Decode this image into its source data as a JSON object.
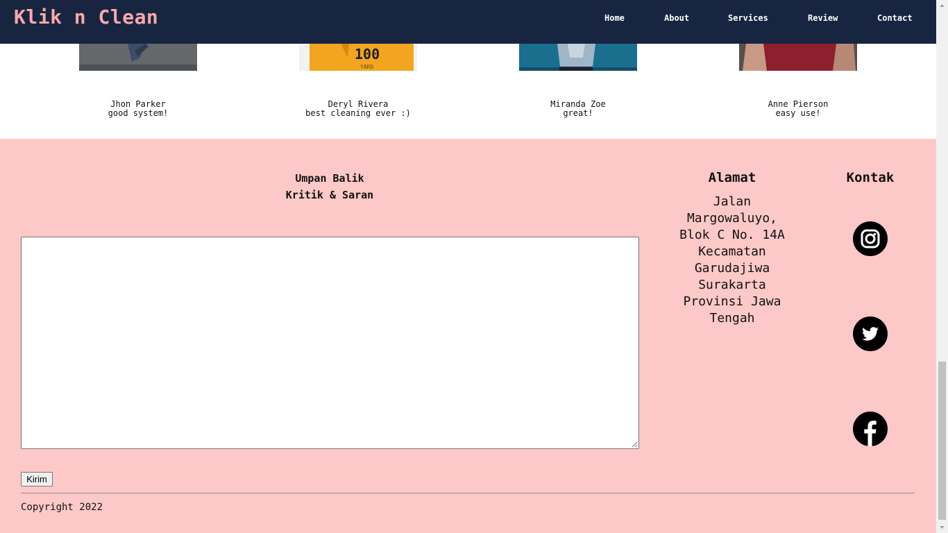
{
  "navbar": {
    "brand": "Klik n Clean",
    "items": [
      {
        "label": "Home"
      },
      {
        "label": "About"
      },
      {
        "label": "Services"
      },
      {
        "label": "Review"
      },
      {
        "label": "Contact"
      }
    ]
  },
  "reviews": [
    {
      "name": "Jhon Parker",
      "comment": "good system!"
    },
    {
      "name": "Deryl Rivera",
      "comment": "best cleaning ever :)"
    },
    {
      "name": "Miranda Zoe",
      "comment": "great!"
    },
    {
      "name": "Anne Pierson",
      "comment": "easy use!"
    }
  ],
  "feedback": {
    "title": "Umpan Balik",
    "subtitle": "Kritik & Saran",
    "textarea_value": "",
    "submit_label": "Kirim"
  },
  "address": {
    "title": "Alamat",
    "text": "Jalan\nMargowaluyo,\nBlok C No. 14A\nKecamatan\nGarudajiwa\nSurakarta\nProvinsi Jawa\nTengah"
  },
  "contact": {
    "title": "Kontak",
    "icons": [
      "instagram-icon",
      "twitter-icon",
      "facebook-icon"
    ]
  },
  "footer": {
    "copyright": "Copyright 2022"
  },
  "colors": {
    "navbar_bg": "#172541",
    "brand": "#f6a9ab",
    "footer_bg": "#fdc8c8"
  }
}
